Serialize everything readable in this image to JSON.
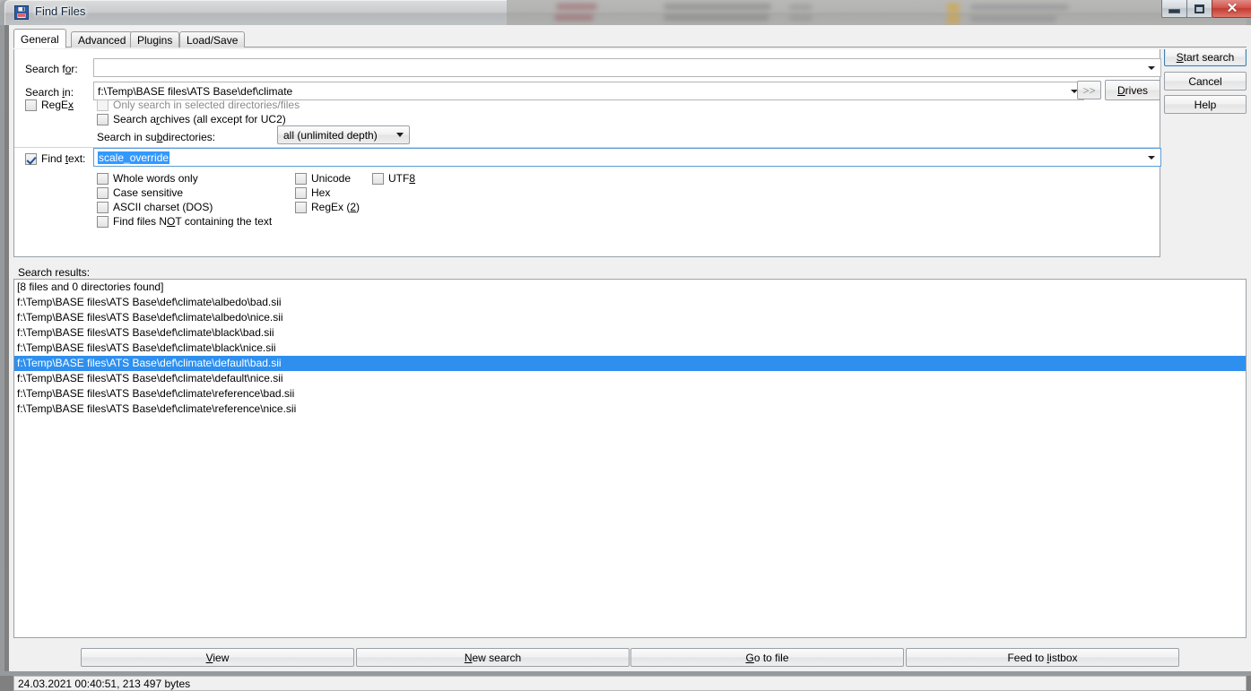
{
  "window": {
    "title": "Find Files",
    "icon": "floppy-disk-save-icon",
    "minimize_label": "–",
    "maximize_label": "□",
    "close_label": "✕"
  },
  "tabs": [
    {
      "label": "General",
      "active": true
    },
    {
      "label": "Advanced",
      "active": false
    },
    {
      "label": "Plugins",
      "active": false
    },
    {
      "label": "Load/Save",
      "active": false
    }
  ],
  "general": {
    "search_for_label": "Search for:",
    "search_for_value": "",
    "search_for_placeholder": "",
    "search_in_label": "Search in:",
    "search_in_value": "f:\\Temp\\BASE files\\ATS Base\\def\\climate",
    "expand_button_label": ">>",
    "drives_button_label": "Drives",
    "regex_label": "RegEx",
    "regex_checked": false,
    "only_selected_label": "Only search in selected directories/files",
    "only_selected_checked": false,
    "only_selected_disabled": true,
    "search_archives_label": "Search archives (all except for UC2)",
    "search_archives_checked": false,
    "subdirs_label": "Search in subdirectories:",
    "subdirs_value": "all (unlimited depth)",
    "find_text_label": "Find text:",
    "find_text_checked": true,
    "find_text_value": "scale_override",
    "options_left": [
      {
        "label": "Whole words only",
        "checked": false
      },
      {
        "label": "Case sensitive",
        "checked": false
      },
      {
        "label": "ASCII charset (DOS)",
        "checked": false
      },
      {
        "label": "Find files NOT containing the text",
        "checked": false
      }
    ],
    "options_mid": [
      {
        "label": "Unicode",
        "checked": false
      },
      {
        "label": "Hex",
        "checked": false
      },
      {
        "label": "RegEx (2)",
        "checked": false
      }
    ],
    "options_right": [
      {
        "label": "UTF8",
        "checked": false
      }
    ]
  },
  "side_buttons": [
    {
      "label": "Start search",
      "focused": true
    },
    {
      "label": "Cancel",
      "focused": false
    },
    {
      "label": "Help",
      "focused": false
    }
  ],
  "results": {
    "label": "Search results:",
    "rows": [
      {
        "text": "[8 files and 0 directories found]",
        "selected": false
      },
      {
        "text": "f:\\Temp\\BASE files\\ATS Base\\def\\climate\\albedo\\bad.sii",
        "selected": false
      },
      {
        "text": "f:\\Temp\\BASE files\\ATS Base\\def\\climate\\albedo\\nice.sii",
        "selected": false
      },
      {
        "text": "f:\\Temp\\BASE files\\ATS Base\\def\\climate\\black\\bad.sii",
        "selected": false
      },
      {
        "text": "f:\\Temp\\BASE files\\ATS Base\\def\\climate\\black\\nice.sii",
        "selected": false
      },
      {
        "text": "f:\\Temp\\BASE files\\ATS Base\\def\\climate\\default\\bad.sii",
        "selected": true
      },
      {
        "text": "f:\\Temp\\BASE files\\ATS Base\\def\\climate\\default\\nice.sii",
        "selected": false
      },
      {
        "text": "f:\\Temp\\BASE files\\ATS Base\\def\\climate\\reference\\bad.sii",
        "selected": false
      },
      {
        "text": "f:\\Temp\\BASE files\\ATS Base\\def\\climate\\reference\\nice.sii",
        "selected": false
      }
    ]
  },
  "bottom_buttons": [
    {
      "label": "View"
    },
    {
      "label": "New search"
    },
    {
      "label": "Go to file"
    },
    {
      "label": "Feed to listbox"
    }
  ],
  "statusbar": {
    "text": "24.03.2021 00:40:51, 213 497 bytes"
  },
  "colors": {
    "selection_blue": "#2e8fee",
    "focus_blue": "#3c7fb1",
    "panel_bg": "#f0f0f0",
    "close_red": "#c33b30"
  }
}
